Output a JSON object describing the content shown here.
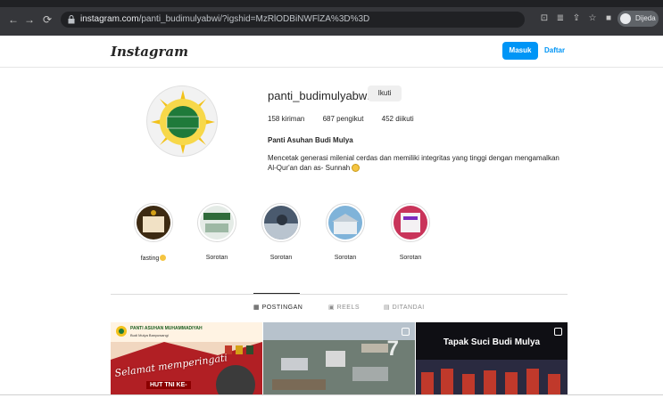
{
  "browser": {
    "url_host": "instagram.com",
    "url_path": "/panti_budimulyabwi/?igshid=MzRlODBiNWFlZA%3D%3D",
    "profile_chip_label": "Dijeda"
  },
  "header": {
    "logo": "Instagram",
    "login_label": "Masuk",
    "signup_label": "Daftar"
  },
  "profile": {
    "username": "panti_budimulyabwi",
    "follow_label": "Ikuti",
    "posts_count": "158 kiriman",
    "followers_count": "687 pengikut",
    "following_count": "452 diikuti",
    "full_name": "Panti Asuhan Budi Mulya",
    "bio": "Mencetak generasi milenial cerdas dan memiliki integritas yang tinggi dengan mengamalkan Al-Qur'an dan as- Sunnah"
  },
  "highlights": [
    {
      "label": "fasting"
    },
    {
      "label": "Sorotan"
    },
    {
      "label": "Sorotan"
    },
    {
      "label": "Sorotan"
    },
    {
      "label": "Sorotan"
    }
  ],
  "tabs": [
    {
      "label": "POSTINGAN",
      "active": true
    },
    {
      "label": "REELS",
      "active": false
    },
    {
      "label": "DITANDAI",
      "active": false
    }
  ],
  "posts": {
    "post1_title": "PANTI ASUHAN MUHAMMADIYAH",
    "post1_sub": "Budi Mulya Banyuwangi",
    "post1_script": "Selamat memperingati",
    "post1_hut": "HUT TNI KE-",
    "post2_num": "7",
    "post3_title": "Tapak Suci Budi Mulya"
  },
  "colors": {
    "accent": "#0095f6",
    "chrome": "#35363a"
  }
}
